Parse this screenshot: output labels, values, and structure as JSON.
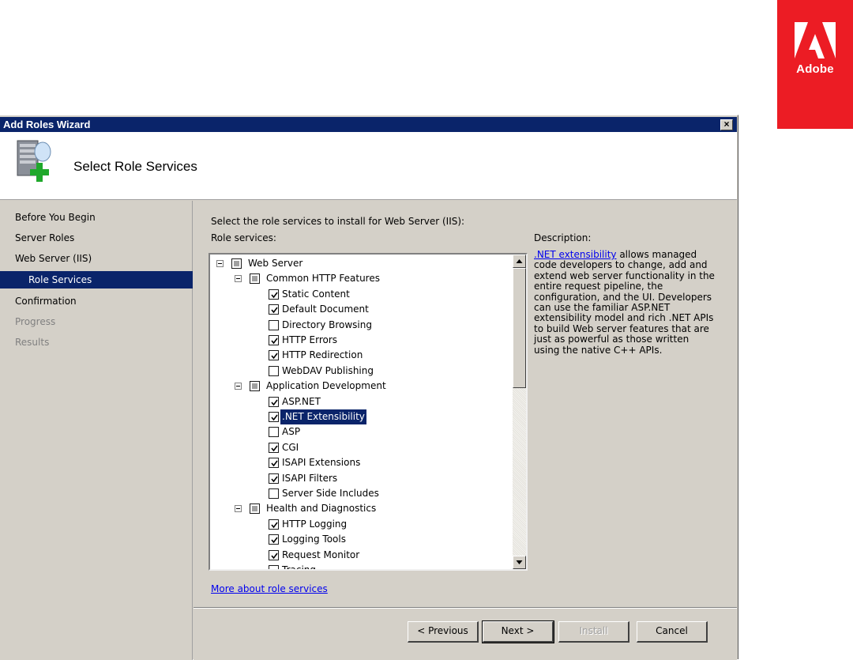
{
  "brand": {
    "name": "Adobe",
    "color": "#ec1c24"
  },
  "window": {
    "title": "Add Roles Wizard",
    "close_glyph": "×"
  },
  "header": {
    "title": "Select Role Services",
    "icon": "server-add-icon"
  },
  "sidebar": {
    "items": [
      {
        "label": "Before You Begin",
        "state": "normal"
      },
      {
        "label": "Server Roles",
        "state": "normal"
      },
      {
        "label": "Web Server (IIS)",
        "state": "normal"
      },
      {
        "label": "Role Services",
        "state": "selected"
      },
      {
        "label": "Confirmation",
        "state": "normal"
      },
      {
        "label": "Progress",
        "state": "disabled"
      },
      {
        "label": "Results",
        "state": "disabled"
      }
    ]
  },
  "main": {
    "instruction": "Select the role services to install for Web Server (IIS):",
    "role_services_label": "Role services:",
    "description_label": "Description:",
    "description_link": ".NET extensibility",
    "description_text": " allows managed code developers to change, add and extend web server functionality in the entire request pipeline, the configuration, and the UI. Developers can use the familiar ASP.NET extensibility model and rich .NET APIs to build Web server features that are just as powerful as those written using the native C++ APIs.",
    "more_link": "More about role services",
    "tree": [
      {
        "label": "Web Server",
        "level": 0,
        "state": "partial",
        "expandable": true
      },
      {
        "label": "Common HTTP Features",
        "level": 1,
        "state": "partial",
        "expandable": true
      },
      {
        "label": "Static Content",
        "level": 2,
        "state": "checked"
      },
      {
        "label": "Default Document",
        "level": 2,
        "state": "checked"
      },
      {
        "label": "Directory Browsing",
        "level": 2,
        "state": "unchecked"
      },
      {
        "label": "HTTP Errors",
        "level": 2,
        "state": "checked"
      },
      {
        "label": "HTTP Redirection",
        "level": 2,
        "state": "checked"
      },
      {
        "label": "WebDAV Publishing",
        "level": 2,
        "state": "unchecked"
      },
      {
        "label": "Application Development",
        "level": 1,
        "state": "partial",
        "expandable": true
      },
      {
        "label": "ASP.NET",
        "level": 2,
        "state": "checked"
      },
      {
        "label": ".NET Extensibility",
        "level": 2,
        "state": "checked",
        "selected": true
      },
      {
        "label": "ASP",
        "level": 2,
        "state": "unchecked"
      },
      {
        "label": "CGI",
        "level": 2,
        "state": "checked"
      },
      {
        "label": "ISAPI Extensions",
        "level": 2,
        "state": "checked"
      },
      {
        "label": "ISAPI Filters",
        "level": 2,
        "state": "checked"
      },
      {
        "label": "Server Side Includes",
        "level": 2,
        "state": "unchecked"
      },
      {
        "label": "Health and Diagnostics",
        "level": 1,
        "state": "partial",
        "expandable": true
      },
      {
        "label": "HTTP Logging",
        "level": 2,
        "state": "checked"
      },
      {
        "label": "Logging Tools",
        "level": 2,
        "state": "checked"
      },
      {
        "label": "Request Monitor",
        "level": 2,
        "state": "checked"
      },
      {
        "label": "Tracing",
        "level": 2,
        "state": "unchecked"
      }
    ]
  },
  "footer": {
    "previous": "< Previous",
    "next": "Next >",
    "install": "Install",
    "cancel": "Cancel"
  }
}
